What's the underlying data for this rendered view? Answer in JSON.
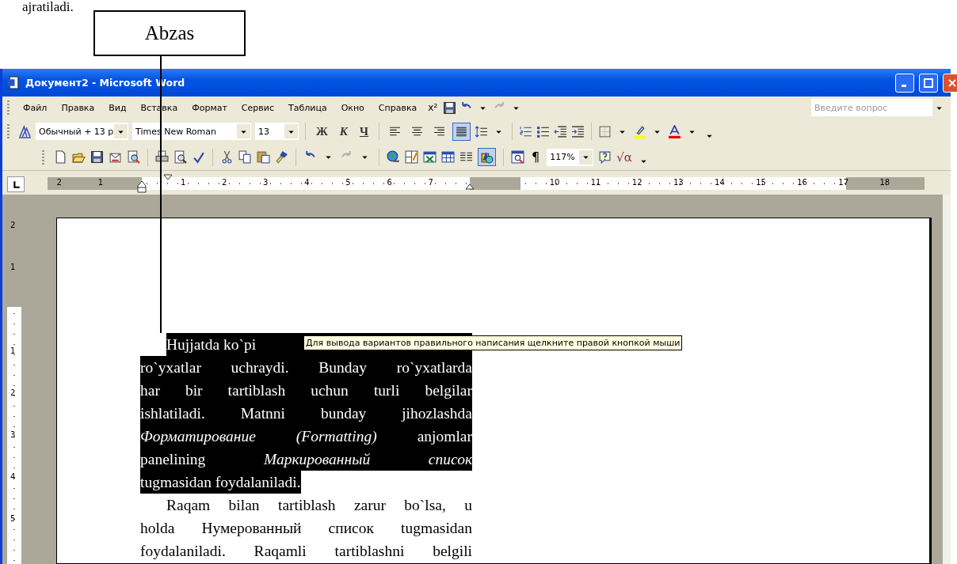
{
  "page_fragment": "ajratiladi.",
  "callout": {
    "label": "Abzas"
  },
  "window": {
    "title": "Документ2 - Microsoft Word"
  },
  "menu_bar": {
    "items": [
      "Файл",
      "Правка",
      "Вид",
      "Вставка",
      "Формат",
      "Сервис",
      "Таблица",
      "Окно",
      "Справка"
    ],
    "superscript": "x²",
    "question_box": {
      "placeholder": "Введите вопрос"
    }
  },
  "formatting_toolbar": {
    "style": "Обычный + 13 р",
    "font": "Times New Roman",
    "size": "13",
    "text_buttons": [
      {
        "label": "Ж"
      },
      {
        "label": "К"
      },
      {
        "label": "Ч"
      }
    ],
    "align_buttons": [
      {
        "selected": false
      },
      {
        "selected": false
      },
      {
        "selected": false
      },
      {
        "selected": true
      }
    ]
  },
  "standard_toolbar": {
    "drawing_toggle": {
      "selected": true
    },
    "pilcrow": "¶",
    "zoom": "117%",
    "equation": "√α"
  },
  "horizontal_ruler": {
    "labels": [
      "2",
      "1",
      "1",
      "2",
      "3",
      "4",
      "5",
      "6",
      "7",
      "10",
      "11",
      "12",
      "13",
      "14",
      "15",
      "16",
      "17",
      "18"
    ]
  },
  "vertical_ruler": {
    "labels": [
      "2",
      "1",
      "1",
      "2",
      "3",
      "4",
      "5"
    ]
  },
  "document": {
    "lines": [
      {
        "text": "Hujjatda     ko`pi",
        "selected": true,
        "indent": true,
        "justified": false
      },
      {
        "text": "ro`yxatlar uchraydi. Bunday ro`yxatlarda",
        "selected": true,
        "indent": false,
        "justified": true
      },
      {
        "text": "har bir tartiblash uchun turli belgilar",
        "selected": true,
        "indent": false,
        "justified": true
      },
      {
        "text": "ishlatiladi. Matnni bunday jihozlashda",
        "selected": true,
        "indent": false,
        "justified": true
      },
      {
        "text": "*Форматирование (Formatting)* anjomlar",
        "selected": true,
        "indent": false,
        "justified": true
      },
      {
        "text": "panelining *Маркированный список*",
        "selected": true,
        "indent": false,
        "justified": true
      },
      {
        "text": "tugmasidan foydalaniladi.",
        "selected": true,
        "indent": false,
        "justified": false
      },
      {
        "text": "Raqam bilan tartiblash zarur bo`lsa, u",
        "selected": false,
        "indent": true,
        "justified": true
      },
      {
        "text": "holda Нумерованный список tugmasidan",
        "selected": false,
        "indent": false,
        "justified": true
      },
      {
        "text": "foydalaniladi. Raqamli tartiblashni belgili",
        "selected": false,
        "indent": false,
        "justified": true
      }
    ]
  },
  "tooltip": {
    "text": "Для вывода вариантов правильного написания щелкните правой кнопкой мыши"
  }
}
